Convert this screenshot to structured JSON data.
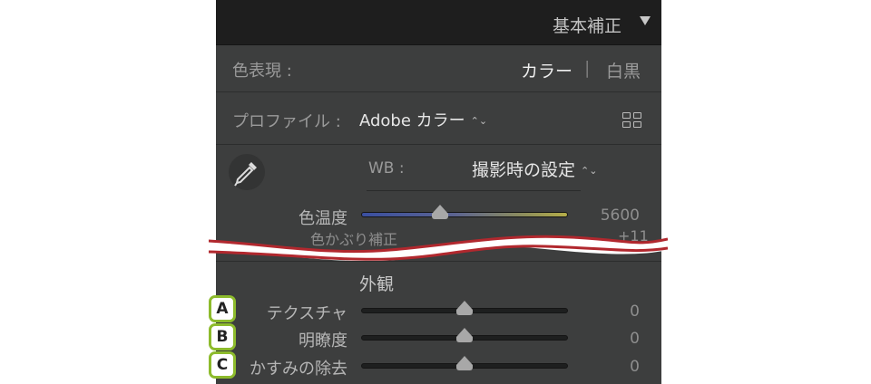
{
  "panel": {
    "title": "基本補正"
  },
  "treatment": {
    "label": "色表現 :",
    "color": "カラー",
    "separator": "|",
    "bw": "白黒"
  },
  "profile": {
    "label": "プロファイル :",
    "value": "Adobe カラー",
    "updown": "⌃⌄"
  },
  "wb": {
    "label": "WB :",
    "value": "撮影時の設定",
    "updown": "⌃⌄"
  },
  "sliders": {
    "temp": {
      "label": "色温度",
      "value": "5600",
      "position": 0.38
    },
    "texture": {
      "label": "テクスチャ",
      "value": "0",
      "position": 0.5
    },
    "clarity": {
      "label": "明瞭度",
      "value": "0",
      "position": 0.5
    },
    "dehaze": {
      "label": "かすみの除去",
      "value": "0",
      "position": 0.5
    }
  },
  "ghost": {
    "label": "色かぶり補正",
    "value": "+11"
  },
  "presence": {
    "title": "外観"
  },
  "badges": {
    "a": "A",
    "b": "B",
    "c": "C"
  },
  "colors": {
    "accent_badge_border": "#8dbb2c",
    "tear_stroke": "#b1282e",
    "panel_bg": "#3d3e3e",
    "header_bg": "#1e1e1e"
  }
}
